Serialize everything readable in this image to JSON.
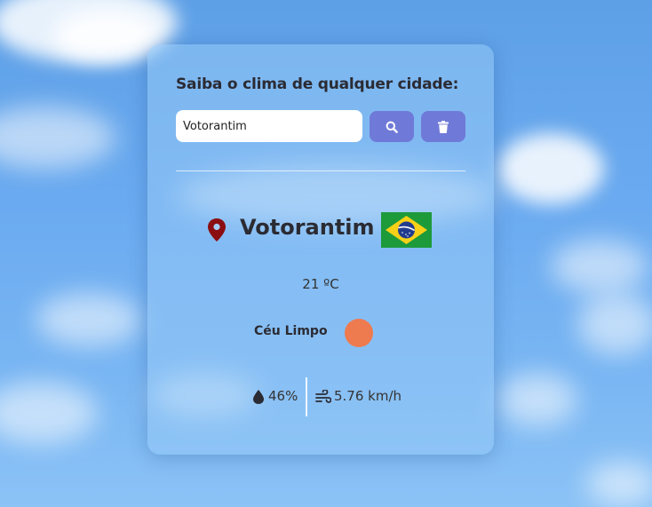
{
  "form": {
    "title": "Saiba o clima de qualquer cidade:",
    "city_input_value": "Votorantim",
    "search_icon": "search-icon",
    "clear_icon": "trash-icon"
  },
  "weather": {
    "city": "Votorantim",
    "country_flag": "Brazil",
    "temperature": "21 ºC",
    "condition": "Céu Limpo",
    "humidity": "46%",
    "wind": "5.76 km/h"
  },
  "colors": {
    "button": "#6f7ad8",
    "pin": "#8b0f12",
    "weather_icon": "#ee7a4f"
  }
}
